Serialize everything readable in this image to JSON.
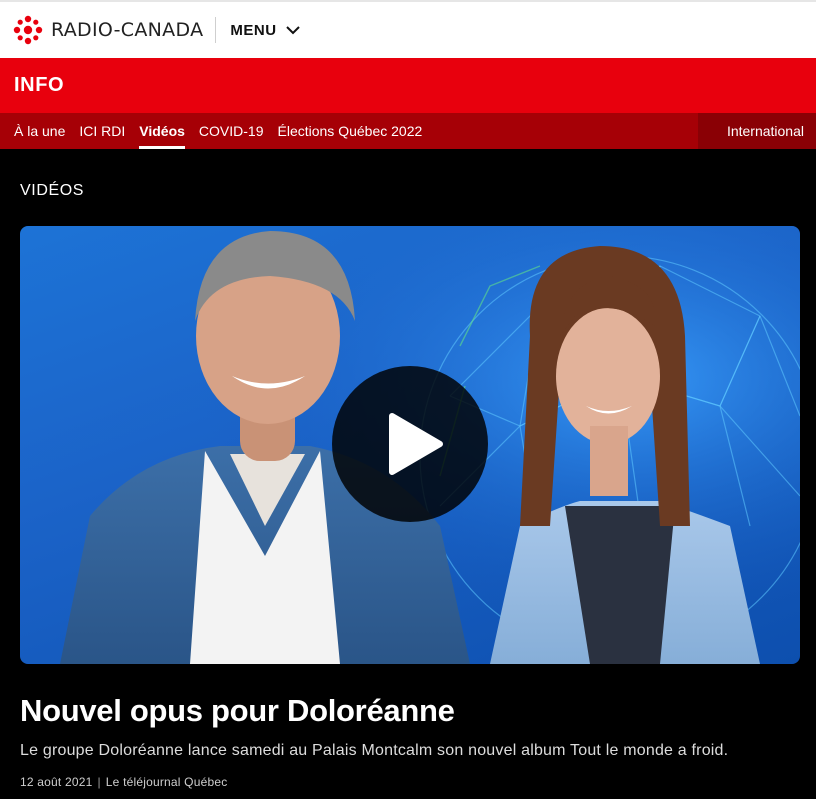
{
  "header": {
    "brand": "RADIO-CANADA",
    "menu_label": "MENU",
    "brand_color": "#e8000d"
  },
  "infobar": {
    "title": "INFO"
  },
  "subnav": {
    "items": [
      {
        "label": "À la une",
        "active": false
      },
      {
        "label": "ICI RDI",
        "active": false
      },
      {
        "label": "Vidéos",
        "active": true
      },
      {
        "label": "COVID-19",
        "active": false
      },
      {
        "label": "Élections Québec 2022",
        "active": false
      }
    ],
    "right_item": "International"
  },
  "main": {
    "section_title": "VIDÉOS",
    "video": {
      "play_icon": "play-icon"
    },
    "headline": "Nouvel opus pour Doloréanne",
    "summary": "Le groupe Doloréanne lance samedi au Palais Montcalm son nouvel album Tout le monde a froid.",
    "date": "12 août 2021",
    "source": "Le téléjournal Québec"
  }
}
